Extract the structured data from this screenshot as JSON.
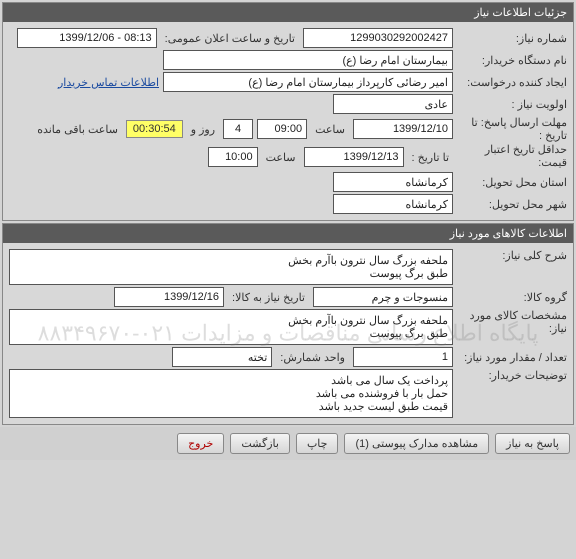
{
  "panel1": {
    "title": "جزئیات اطلاعات نیاز",
    "need_number": {
      "label": "شماره نیاز:",
      "value": "1299030292002427"
    },
    "announce": {
      "label": "تاریخ و ساعت اعلان عمومی:",
      "value": "08:13 - 1399/12/06"
    },
    "buyer_name": {
      "label": "نام دستگاه خریدار:",
      "value": "بیمارستان امام رضا (ع)"
    },
    "requester": {
      "label": "ایجاد کننده درخواست:",
      "value": "امیر رضائی کارپرداز بیمارستان امام رضا (ع)"
    },
    "contact_link": "اطلاعات تماس خریدار",
    "priority": {
      "label": "اولویت نیاز :",
      "value": "عادی"
    },
    "deadline": {
      "label": "مهلت ارسال پاسخ:  تا تاریخ :",
      "date": "1399/12/10",
      "saat": "ساعت",
      "time": "09:00",
      "days": "4",
      "rooz_va": "روز و",
      "counter": "00:30:54",
      "remaining": "ساعت باقی مانده"
    },
    "min_validity": {
      "label": "حداقل تاریخ اعتبار قیمت:",
      "ta_tarikh": "تا تاریخ :",
      "date": "1399/12/13",
      "saat": "ساعت",
      "time": "10:00"
    },
    "province": {
      "label": "استان محل تحویل:",
      "value": "کرمانشاه"
    },
    "city": {
      "label": "شهر محل تحویل:",
      "value": "کرمانشاه"
    }
  },
  "panel2": {
    "title": "اطلاعات کالاهای مورد نیاز",
    "general_desc": {
      "label": "شرح کلی نیاز:",
      "value": "ملحفه بزرگ سال نترون باآرم بخش\nطبق برگ پیوست"
    },
    "group": {
      "label": "گروه کالا:",
      "value": "منسوجات و چرم",
      "date_label": "تاریخ نیاز به کالا:",
      "date_value": "1399/12/16"
    },
    "spec": {
      "label": "مشخصات کالای مورد نیاز:",
      "value": "ملحفه بزرگ سال نترون باآرم بخش\nطبق برگ پیوست"
    },
    "qty": {
      "label": "تعداد / مقدار مورد نیاز:",
      "value": "1",
      "unit_label": "واحد شمارش:",
      "unit_value": "تخته"
    },
    "buyer_notes": {
      "label": "توضیحات خریدار:",
      "value": "پرداخت یک سال می باشد\nحمل بار با فروشنده می باشد\nقیمت طبق لیست جدید باشد"
    }
  },
  "buttons": {
    "reply": "پاسخ به نیاز",
    "attachments": "مشاهده مدارک پیوستی (1)",
    "print": "چاپ",
    "back": "بازگشت",
    "exit": "خروج"
  },
  "watermark": "پایگاه اطلاع رسانی مناقصات و مزایدات\n۰۲۱-۸۸۳۴۹۶۷۰"
}
